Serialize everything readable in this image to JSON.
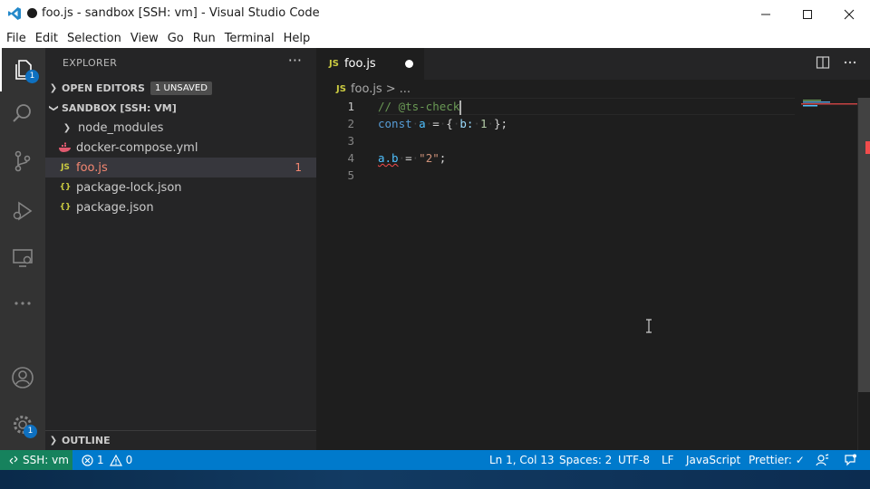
{
  "window": {
    "title": "foo.js - sandbox [SSH: vm] - Visual Studio Code"
  },
  "menu": [
    "File",
    "Edit",
    "Selection",
    "View",
    "Go",
    "Run",
    "Terminal",
    "Help"
  ],
  "activity": {
    "explorer_badge": "1",
    "settings_badge": "1"
  },
  "sidebar": {
    "title": "EXPLORER",
    "more": "···",
    "open_editors": {
      "label": "OPEN EDITORS",
      "badge": "1 UNSAVED"
    },
    "workspace": "SANDBOX [SSH: VM]",
    "files": [
      {
        "name": "node_modules",
        "icon": "chevron-right-icon"
      },
      {
        "name": "docker-compose.yml",
        "icon": "docker-icon"
      },
      {
        "name": "foo.js",
        "icon": "js-file-icon",
        "icon_text": "JS",
        "problems": "1"
      },
      {
        "name": "package-lock.json",
        "icon": "json-file-icon",
        "icon_text": "{}"
      },
      {
        "name": "package.json",
        "icon": "json-file-icon",
        "icon_text": "{}"
      }
    ],
    "outline": "OUTLINE"
  },
  "editor": {
    "tab": {
      "icon_text": "JS",
      "label": "foo.js"
    },
    "breadcrumb": {
      "icon_text": "JS",
      "file": "foo.js",
      "sep": ">",
      "more": "..."
    },
    "lines": [
      {
        "n": "1",
        "t_comment": "// @ts-check"
      },
      {
        "n": "2",
        "t_kw": "const",
        "t_var": "a",
        "t_eq": "=",
        "t_open": "{",
        "t_prop": "b:",
        "t_num": "1",
        "t_close": "};"
      },
      {
        "n": "3"
      },
      {
        "n": "4",
        "t_obj": "a.b",
        "t_eq": "=",
        "t_str": "\"2\"",
        "t_semi": ";"
      },
      {
        "n": "5"
      }
    ]
  },
  "status": {
    "remote": "SSH: vm",
    "errors": "1",
    "warnings": "0",
    "position": "Ln 1, Col 13",
    "spaces": "Spaces: 2",
    "encoding": "UTF-8",
    "eol": "LF",
    "language": "JavaScript",
    "formatter": "Prettier: ✓"
  },
  "colors": {
    "accent": "#007acc",
    "remote": "#16825d",
    "error": "#f14c4c"
  }
}
